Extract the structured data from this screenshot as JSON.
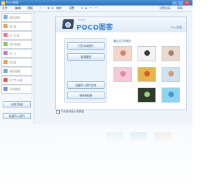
{
  "titlebar": {
    "title": "Poco图客",
    "minimize": "—",
    "maximize": "□",
    "close": "✕"
  },
  "menu": {
    "items": [
      "文件",
      "编辑",
      "模板",
      "操作",
      "设置",
      "帮助"
    ]
  },
  "topright": {
    "first": "设置向导",
    "second": "帮助"
  },
  "sidebar": {
    "items": [
      {
        "label": "美化照片",
        "icon": "photo-icon",
        "color": "#7db3e6"
      },
      {
        "label": "相 框",
        "icon": "frame-icon",
        "color": "#d9a760"
      },
      {
        "label": "大 头 贴",
        "icon": "sticker-icon",
        "color": "#e67a8f"
      },
      {
        "label": "照片拼图",
        "icon": "collage-icon",
        "color": "#8fc06a"
      },
      {
        "label": "办 公",
        "icon": "office-icon",
        "color": "#c07ac9"
      },
      {
        "label": "相 册",
        "icon": "album-icon",
        "color": "#e6a050"
      },
      {
        "label": "便签相框",
        "icon": "note-icon",
        "color": "#6ab0c4"
      },
      {
        "label": "文 字 头像",
        "icon": "text-icon",
        "color": "#d66060"
      },
      {
        "label": "手机壁纸",
        "icon": "phone-icon",
        "color": "#7d8fd6"
      }
    ],
    "btn1": "浏览/管理",
    "btn2": "批量导入图片"
  },
  "main": {
    "logo_sub": "PCUSE",
    "logo_text": "POCO图客",
    "brand": "Poco图客",
    "buttons": {
      "open": "打开本地图片",
      "browse": "屏幕截图",
      "batch_import": "批量导入图片生成",
      "new_album": "制作新相册"
    },
    "recent_title": "最近打开的照片",
    "checkbox_label": "下次启动显示本界面"
  },
  "thumbnails": [
    {
      "name": "thumb-baby",
      "c1": "#f3d6c9",
      "c2": "#c98a6d"
    },
    {
      "name": "thumb-camera",
      "c1": "#f2f2f2",
      "c2": "#3a3a3a"
    },
    {
      "name": "thumb-portrait",
      "c1": "#e9d9cf",
      "c2": "#b07d6b"
    },
    {
      "name": "thumb-kid-pink",
      "c1": "#f6c8d8",
      "c2": "#e08aa8"
    },
    {
      "name": "thumb-flowers",
      "c1": "#e7b44c",
      "c2": "#d45a2a"
    },
    {
      "name": "thumb-couple",
      "c1": "#cfe2f0",
      "c2": "#d69a7a"
    },
    {
      "name": "thumb-green-frame",
      "c1": "#2f3b2a",
      "c2": "#9fd07a"
    },
    {
      "name": "thumb-sea",
      "c1": "#8fd3ef",
      "c2": "#3b9ec9"
    }
  ]
}
